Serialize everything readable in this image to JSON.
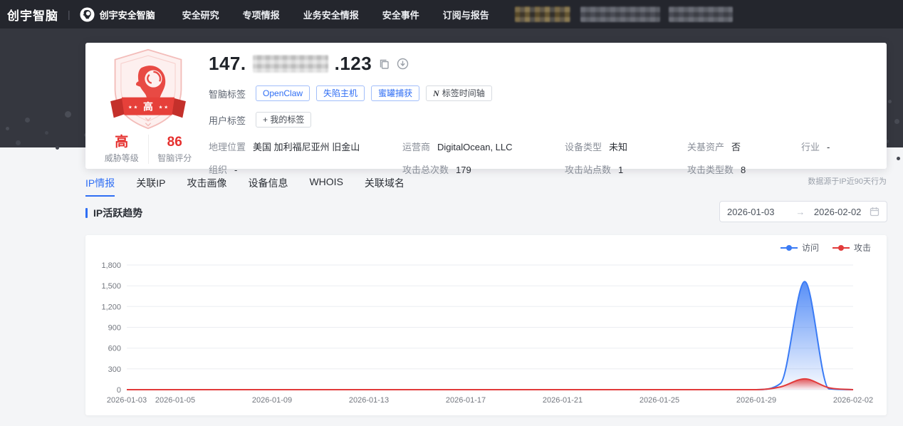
{
  "nav": {
    "brand": "创宇智脑",
    "divider": "|",
    "product": "创宇安全智脑",
    "items": [
      "安全研究",
      "专项情报",
      "业务安全情报",
      "安全事件",
      "订阅与报告"
    ]
  },
  "profile": {
    "ip_prefix": "147.",
    "ip_suffix": ".123",
    "badge_text": "高",
    "badge_stars": "★ ★",
    "threat_level": "高",
    "threat_level_label": "威胁等级",
    "score": "86",
    "score_label": "智脑评分",
    "smart_tags_label": "智脑标签",
    "smart_tags": [
      "OpenClaw",
      "失陷主机",
      "蜜罐捕获"
    ],
    "timeline_tag_icon": "N",
    "timeline_tag_label": "标签时间轴",
    "user_tags_label": "用户标签",
    "add_tag_label": "+ 我的标签",
    "fields": [
      {
        "label": "地理位置",
        "value": "美国 加利福尼亚州 旧金山"
      },
      {
        "label": "运营商",
        "value": "DigitalOcean, LLC"
      },
      {
        "label": "设备类型",
        "value": "未知"
      },
      {
        "label": "关基资产",
        "value": "否"
      },
      {
        "label": "行业",
        "value": "-"
      },
      {
        "label": "组织",
        "value": "-"
      },
      {
        "label": "攻击总次数",
        "value": "179"
      },
      {
        "label": "攻击站点数",
        "value": "1"
      },
      {
        "label": "攻击类型数",
        "value": "8"
      }
    ]
  },
  "tabs": {
    "active_index": 0,
    "items": [
      "IP情报",
      "关联IP",
      "攻击画像",
      "设备信息",
      "WHOIS",
      "关联域名"
    ]
  },
  "note": "数据源于IP近90天行为",
  "section": {
    "title": "IP活跃趋势",
    "date_start": "2026-01-03",
    "arrow": "→",
    "date_end": "2026-02-02"
  },
  "chart_data": {
    "type": "area",
    "title": "IP活跃趋势",
    "grid": true,
    "legend_position": "top-right",
    "ylim": [
      0,
      1800
    ],
    "yticks": [
      {
        "value": 0,
        "label": "0"
      },
      {
        "value": 300,
        "label": "300"
      },
      {
        "value": 600,
        "label": "600"
      },
      {
        "value": 900,
        "label": "900"
      },
      {
        "value": 1200,
        "label": "1,200"
      },
      {
        "value": 1500,
        "label": "1,500"
      },
      {
        "value": 1800,
        "label": "1,800"
      }
    ],
    "x": [
      "2026-01-03",
      "2026-01-04",
      "2026-01-05",
      "2026-01-06",
      "2026-01-07",
      "2026-01-08",
      "2026-01-09",
      "2026-01-10",
      "2026-01-11",
      "2026-01-12",
      "2026-01-13",
      "2026-01-14",
      "2026-01-15",
      "2026-01-16",
      "2026-01-17",
      "2026-01-18",
      "2026-01-19",
      "2026-01-20",
      "2026-01-21",
      "2026-01-22",
      "2026-01-23",
      "2026-01-24",
      "2026-01-25",
      "2026-01-26",
      "2026-01-27",
      "2026-01-28",
      "2026-01-29",
      "2026-01-30",
      "2026-01-31",
      "2026-02-01",
      "2026-02-02"
    ],
    "xtick_indices": [
      0,
      2,
      6,
      10,
      14,
      18,
      22,
      26,
      30
    ],
    "series": [
      {
        "name": "访问",
        "color": "#3a7bf5",
        "values": [
          0,
          0,
          0,
          0,
          0,
          0,
          0,
          0,
          0,
          0,
          0,
          0,
          0,
          0,
          0,
          0,
          0,
          0,
          0,
          0,
          0,
          0,
          0,
          0,
          0,
          0,
          0,
          90,
          1560,
          12,
          0
        ]
      },
      {
        "name": "攻击",
        "color": "#e23b3b",
        "values": [
          0,
          0,
          0,
          0,
          0,
          0,
          0,
          0,
          0,
          0,
          0,
          0,
          0,
          0,
          0,
          0,
          0,
          0,
          0,
          0,
          0,
          0,
          0,
          0,
          0,
          0,
          0,
          40,
          155,
          28,
          0
        ]
      }
    ]
  }
}
